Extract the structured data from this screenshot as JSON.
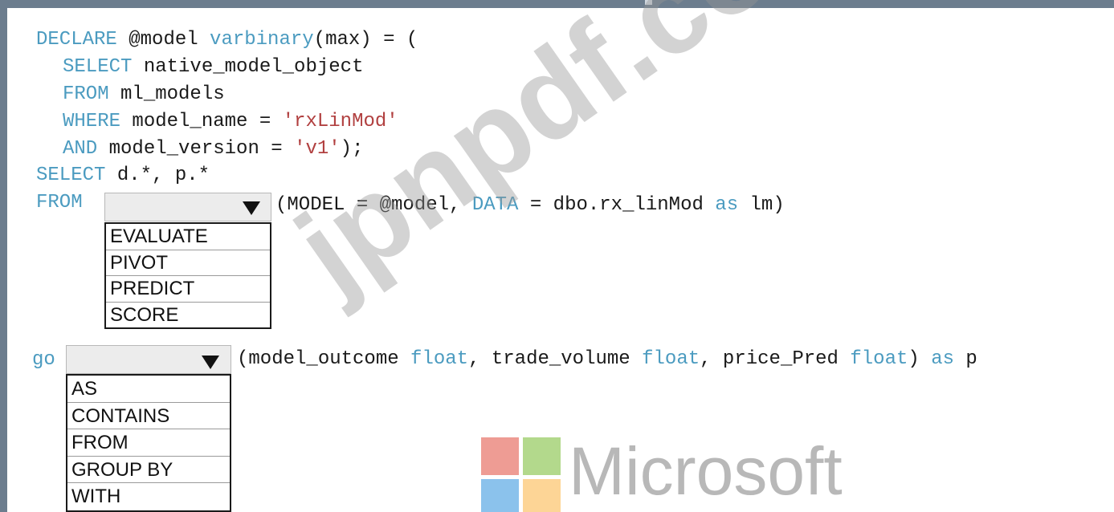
{
  "code": {
    "line1": {
      "kw1": "DECLARE",
      "t1": " @model ",
      "kw2": "varbinary",
      "t2": "(max) = ("
    },
    "line2": {
      "kw1": "SELECT",
      "t1": " native_model_object"
    },
    "line3": {
      "kw1": "FROM",
      "t1": " ml_models"
    },
    "line4": {
      "kw1": "WHERE",
      "t1": " model_name = ",
      "str1": "'rxLinMod'"
    },
    "line5": {
      "kw1": "AND",
      "t1": " model_version = ",
      "str1": "'v1'",
      "t2": ");"
    },
    "line6": {
      "kw1": "SELECT",
      "t1": " d.*, p.*"
    },
    "line7": {
      "kw1": "FROM"
    },
    "line8": {
      "t1": "(MODEL = @model, ",
      "kw1": "DATA",
      "t2": " = dbo.rx_linMod ",
      "kw2": "as",
      "t3": " lm)"
    },
    "line9": {
      "kw1": "go"
    },
    "line10": {
      "t1": "(model_outcome ",
      "kw1": "float",
      "t2": ", trade_volume ",
      "kw2": "float",
      "t3": ", price_Pred ",
      "kw3": "float",
      "t4": ") ",
      "kw4": "as",
      "t5": " p"
    }
  },
  "dropdown1": {
    "selected": "",
    "options": [
      "EVALUATE",
      "PIVOT",
      "PREDICT",
      "SCORE"
    ]
  },
  "dropdown2": {
    "selected": "",
    "options": [
      "AS",
      "CONTAINS",
      "FROM",
      "GROUP BY",
      "WITH"
    ]
  },
  "watermark": {
    "text": "jpnpdf.com"
  },
  "logo": {
    "text": "Microsoft",
    "colors": {
      "red": "#ee9c94",
      "green": "#b3d98c",
      "blue": "#8bc2ec",
      "yellow": "#fdd596"
    }
  },
  "colors": {
    "keyword": "#4b9bc0",
    "string": "#b14040",
    "frame": "#6c7d8e"
  }
}
